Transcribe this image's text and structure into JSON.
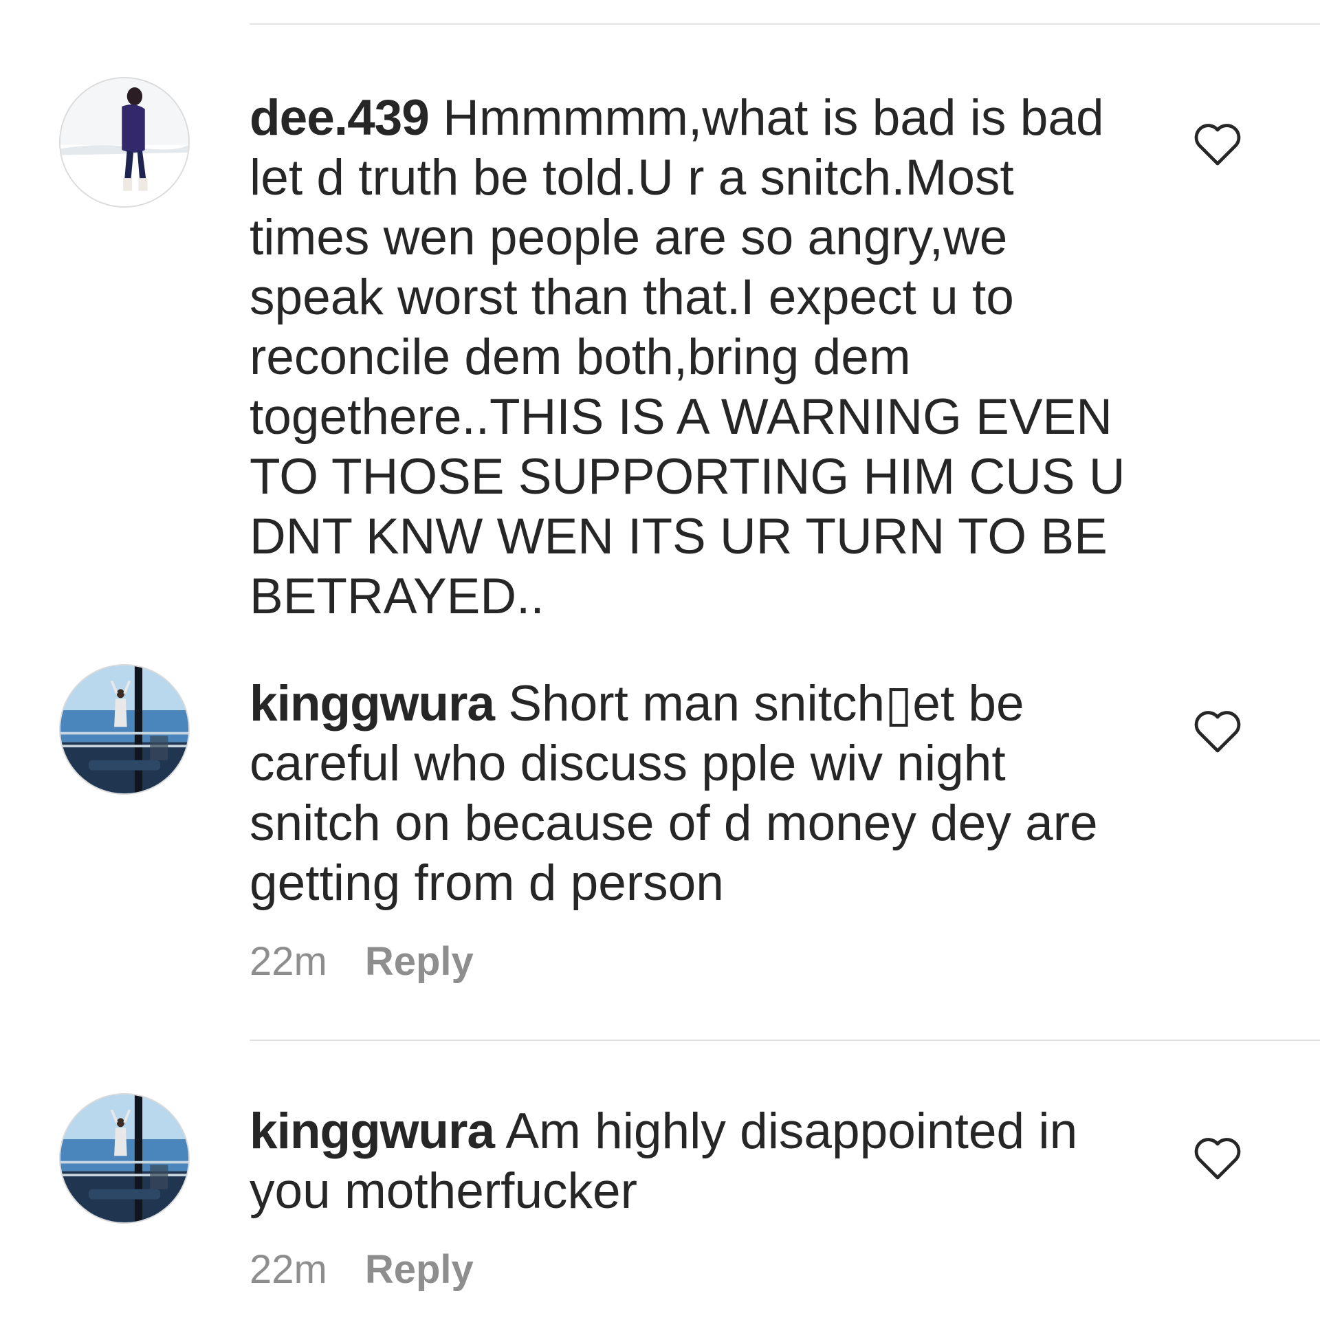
{
  "comments": [
    {
      "username": "dee.439",
      "text": "Hmmmmm,what is bad is bad let d truth be told.U r a snitch.Most times wen people are so angry,we speak worst than that.I expect u to reconcile dem both,bring dem togethere..THIS IS A WARNING EVEN TO THOSE SUPPORTING HIM CUS U DNT KNW WEN ITS UR TURN TO BE BETRAYED..",
      "avatar_icon": "profile-photo-woman-snow",
      "like_icon": "heart-outline-icon"
    },
    {
      "username": "kinggwura",
      "text": "Short man snitch▯et be careful who discuss pple wiv night snitch on because of d money dey are getting from d person",
      "time": "22m",
      "reply_label": "Reply",
      "avatar_icon": "profile-photo-balcony",
      "like_icon": "heart-outline-icon"
    },
    {
      "username": "kinggwura",
      "text": "Am highly disappointed in you motherfucker",
      "time": "22m",
      "reply_label": "Reply",
      "avatar_icon": "profile-photo-balcony",
      "like_icon": "heart-outline-icon"
    }
  ],
  "colors": {
    "text": "#262626",
    "meta": "#8e8e8e",
    "divider": "#e3e3e3"
  }
}
